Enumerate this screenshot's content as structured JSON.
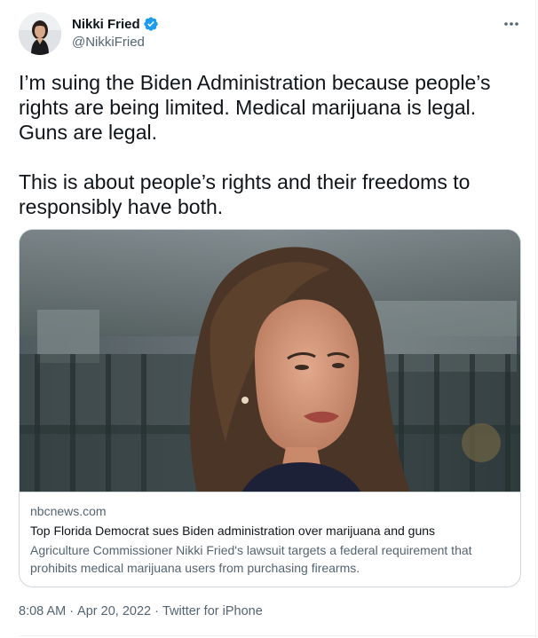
{
  "author": {
    "display_name": "Nikki Fried",
    "handle": "@NikkiFried",
    "verified": true,
    "verified_color": "#1d9bf0"
  },
  "tweet": {
    "text": "I’m suing the Biden Administration because people’s rights are being limited. Medical marijuana is legal. Guns are legal.\n\nThis is about people’s rights and their freedoms to responsibly have both."
  },
  "card": {
    "domain": "nbcnews.com",
    "title": "Top Florida Democrat sues Biden administration over marijuana and guns",
    "description": "Agriculture Commissioner Nikki Fried's lawsuit targets a federal requirement that prohibits medical marijuana users from purchasing firearms."
  },
  "meta": {
    "time": "8:08 AM",
    "separator": "·",
    "date": "Apr 20, 2022",
    "source": "Twitter for iPhone"
  },
  "icons": {
    "more": "more-options-icon",
    "verified": "verified-badge-icon"
  }
}
